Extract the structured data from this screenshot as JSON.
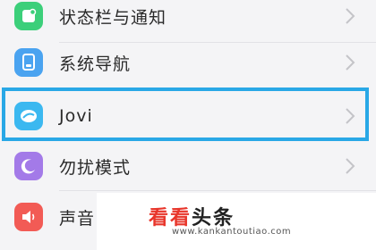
{
  "settings_list": {
    "items": [
      {
        "label": "状态栏与通知",
        "icon": "notification-panel-icon",
        "icon_color": "#3ccf7a"
      },
      {
        "label": "系统导航",
        "icon": "phone-navigation-icon",
        "icon_color": "#4aa3f0"
      },
      {
        "label": "Jovi",
        "icon": "jovi-assistant-icon",
        "icon_color": "#3bb8f0"
      },
      {
        "label": "勿扰模式",
        "icon": "moon-icon",
        "icon_color": "#a37ae8"
      },
      {
        "label": "声音",
        "icon": "speaker-icon",
        "icon_color": "#f25b55"
      }
    ]
  },
  "highlight_color": "#29a8e6",
  "watermark": {
    "brand_part1": "看看",
    "brand_part2": "头条",
    "url": "www.kankantoutiao.com"
  }
}
